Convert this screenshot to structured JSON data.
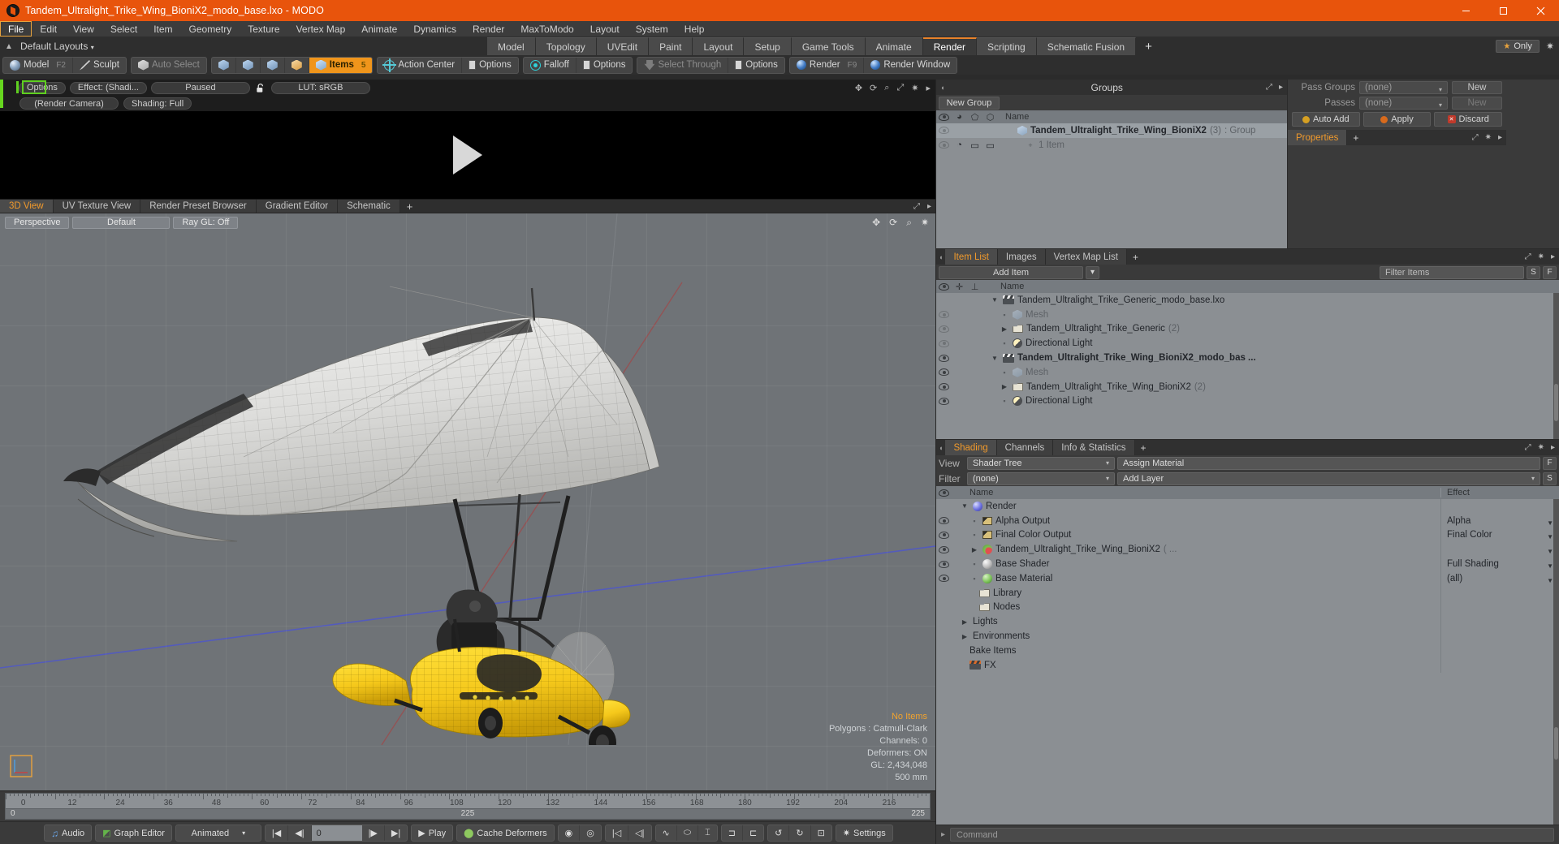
{
  "titlebar": {
    "title": "Tandem_Ultralight_Trike_Wing_BioniX2_modo_base.lxo - MODO"
  },
  "menu": {
    "items": [
      "File",
      "Edit",
      "View",
      "Select",
      "Item",
      "Geometry",
      "Texture",
      "Vertex Map",
      "Animate",
      "Dynamics",
      "Render",
      "MaxToModo",
      "Layout",
      "System",
      "Help"
    ],
    "active": "File"
  },
  "layoutbar": {
    "default_layouts": "Default Layouts",
    "tabs": [
      "Model",
      "Topology",
      "UVEdit",
      "Paint",
      "Layout",
      "Setup",
      "Game Tools",
      "Animate",
      "Render",
      "Scripting",
      "Schematic Fusion"
    ],
    "selected_tab": "Render",
    "plus": "+",
    "only_label": "Only"
  },
  "toolbar": {
    "mode_model": "Model",
    "mode_model_key": "F2",
    "mode_sculpt": "Sculpt",
    "auto_select": "Auto Select",
    "items": "Items",
    "items_key": "5",
    "action_center": "Action Center",
    "options1": "Options",
    "falloff": "Falloff",
    "options2": "Options",
    "select_through": "Select Through",
    "options3": "Options",
    "render": "Render",
    "render_key": "F9",
    "render_window": "Render Window"
  },
  "render_preview": {
    "options": "Options",
    "effect": "Effect: (Shadi...",
    "status": "Paused",
    "lut": "LUT: sRGB",
    "camera": "(Render Camera)",
    "shading": "Shading: Full"
  },
  "viewtabs": {
    "tabs": [
      "3D View",
      "UV Texture View",
      "Render Preset Browser",
      "Gradient Editor",
      "Schematic"
    ],
    "selected": "3D View",
    "plus": "+"
  },
  "viewport": {
    "perspective": "Perspective",
    "default": "Default",
    "raygl": "Ray GL: Off",
    "info": {
      "items": "No Items",
      "polygons": "Polygons : Catmull-Clark",
      "channels": "Channels: 0",
      "deformers": "Deformers: ON",
      "gl": "GL: 2,434,048",
      "scale": "500 mm"
    }
  },
  "timeline": {
    "ticks": [
      "0",
      "12",
      "24",
      "36",
      "48",
      "60",
      "72",
      "84",
      "96",
      "108",
      "120",
      "132",
      "144",
      "156",
      "168",
      "180",
      "192",
      "204",
      "216"
    ],
    "range_start": "0",
    "range_mid": "225",
    "range_end": "225",
    "end_marker": "225"
  },
  "bottombar": {
    "audio": "Audio",
    "graph_editor": "Graph Editor",
    "animated": "Animated",
    "frame": "0",
    "play": "Play",
    "cache_deformers": "Cache Deformers",
    "settings": "Settings"
  },
  "groups_panel": {
    "title": "Groups",
    "new_group": "New Group",
    "name_col": "Name",
    "rows": [
      {
        "name": "Tandem_Ultralight_Trike_Wing_BioniX2",
        "count": "(3)",
        "suffix": ": Group",
        "sub": "1 Item"
      }
    ]
  },
  "item_list": {
    "tabs": [
      "Item List",
      "Images",
      "Vertex Map List"
    ],
    "selected": "Item List",
    "plus": "+",
    "add_item": "Add Item",
    "filter_items": "Filter Items",
    "btn_s": "S",
    "btn_f": "F",
    "name_col": "Name",
    "rows": [
      {
        "label": "Tandem_Ultralight_Trike_Generic_modo_base.lxo",
        "icon": "clapper-icon",
        "indent": 0,
        "twist": "down",
        "eye": false,
        "bold": false,
        "count": ""
      },
      {
        "label": "Mesh",
        "icon": "mesh-icon",
        "indent": 1,
        "twist": "none",
        "eye": true,
        "dim": true,
        "bold": false,
        "count": ""
      },
      {
        "label": "Tandem_Ultralight_Trike_Generic",
        "icon": "folder-icon",
        "indent": 1,
        "twist": "right",
        "eye": true,
        "bold": false,
        "count": "(2)"
      },
      {
        "label": "Directional Light",
        "icon": "light-icon",
        "indent": 1,
        "twist": "none",
        "eye": true,
        "bold": false,
        "count": ""
      },
      {
        "label": "Tandem_Ultralight_Trike_Wing_BioniX2_modo_bas ...",
        "icon": "clapper-icon",
        "indent": 0,
        "twist": "down",
        "eye": true,
        "bold": true,
        "count": ""
      },
      {
        "label": "Mesh",
        "icon": "mesh-icon",
        "indent": 1,
        "twist": "none",
        "eye": true,
        "dim": true,
        "bold": false,
        "count": ""
      },
      {
        "label": "Tandem_Ultralight_Trike_Wing_BioniX2",
        "icon": "folder-icon",
        "indent": 1,
        "twist": "right",
        "eye": true,
        "bold": false,
        "count": "(2)"
      },
      {
        "label": "Directional Light",
        "icon": "light-icon",
        "indent": 1,
        "twist": "none",
        "eye": true,
        "bold": false,
        "count": ""
      }
    ]
  },
  "shading_panel": {
    "tabs": [
      "Shading",
      "Channels",
      "Info & Statistics"
    ],
    "selected": "Shading",
    "plus": "+",
    "view_label": "View",
    "view_value": "Shader Tree",
    "assign_material": "Assign Material",
    "btn_f": "F",
    "filter_label": "Filter",
    "filter_value": "(none)",
    "add_layer": "Add Layer",
    "btn_s": "S",
    "col_name": "Name",
    "col_effect": "Effect",
    "rows": [
      {
        "label": "Render",
        "effect": "",
        "icon": "sphere-blue-icon",
        "indent": 0,
        "twist": "down",
        "eye": false,
        "caret": false
      },
      {
        "label": "Alpha Output",
        "effect": "Alpha",
        "icon": "image-icon",
        "indent": 1,
        "twist": "none",
        "eye": true,
        "caret": true
      },
      {
        "label": "Final Color Output",
        "effect": "Final Color",
        "icon": "image-icon",
        "indent": 1,
        "twist": "none",
        "eye": true,
        "caret": true
      },
      {
        "label": "Tandem_Ultralight_Trike_Wing_BioniX2",
        "suffix": "( ...",
        "effect": "",
        "icon": "material-group-icon",
        "indent": 1,
        "twist": "right",
        "eye": true,
        "caret": true
      },
      {
        "label": "Base Shader",
        "effect": "Full Shading",
        "icon": "sphere-gray-icon",
        "indent": 1,
        "twist": "none",
        "eye": true,
        "caret": true
      },
      {
        "label": "Base Material",
        "effect": "(all)",
        "icon": "sphere-green-icon",
        "indent": 1,
        "twist": "none",
        "eye": true,
        "caret": true
      },
      {
        "label": "Library",
        "effect": "",
        "icon": "folder-icon",
        "indent": 1,
        "twist": "none",
        "eye": false,
        "caret": false
      },
      {
        "label": "Nodes",
        "effect": "",
        "icon": "folder-icon",
        "indent": 1,
        "twist": "none",
        "eye": false,
        "caret": false
      },
      {
        "label": "Lights",
        "effect": "",
        "icon": "none",
        "indent": 0,
        "twist": "right",
        "eye": false,
        "caret": false
      },
      {
        "label": "Environments",
        "effect": "",
        "icon": "none",
        "indent": 0,
        "twist": "right",
        "eye": false,
        "caret": false
      },
      {
        "label": "Bake Items",
        "effect": "",
        "icon": "none",
        "indent": 0,
        "twist": "none",
        "eye": false,
        "caret": false
      },
      {
        "label": "FX",
        "effect": "",
        "icon": "fx-icon",
        "indent": 0,
        "twist": "none",
        "eye": false,
        "caret": false
      }
    ]
  },
  "properties_right": {
    "pass_groups_label": "Pass Groups",
    "pass_groups_value": "(none)",
    "new_btn_1": "New",
    "passes_label": "Passes",
    "passes_value": "(none)",
    "new_btn_2": "New",
    "auto_add": "Auto Add",
    "apply": "Apply",
    "discard": "Discard",
    "properties_tab": "Properties",
    "plus": "+"
  },
  "command_bar": {
    "placeholder": "Command"
  },
  "colors": {
    "title_bar": "#e8540c",
    "accent_orange": "#f19a2c",
    "highlight_green": "#5fd020",
    "panel_bg": "#3a3a3a",
    "list_bg": "#8b8f93"
  }
}
